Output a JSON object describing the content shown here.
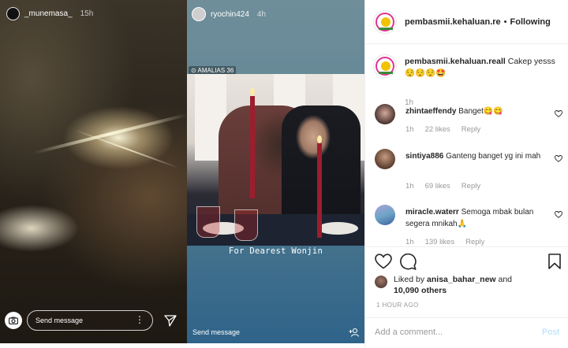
{
  "story1": {
    "username": "_munemasa_",
    "time": "15h",
    "message_placeholder": "Send message"
  },
  "story2": {
    "username": "ryochin424",
    "time": "4h",
    "photo_tag": "AMALIAS 36",
    "caption": "For Dearest Wonjin",
    "message_placeholder": "Send message"
  },
  "post": {
    "header": {
      "username": "pembasmii.kehaluan.re",
      "separator": "•",
      "follow_label": "Following",
      "more": "•••"
    },
    "caption": {
      "username": "pembasmii.kehaluan.reall",
      "text": "Cakep yesss 😌😌😌🤩",
      "time": "1h"
    },
    "comments": [
      {
        "username": "zhintaeffendy",
        "text": "Banget😋😋",
        "time": "1h",
        "likes": "22 likes",
        "reply": "Reply"
      },
      {
        "username": "sintiya886",
        "text": "Ganteng banget yg ini mah",
        "time": "1h",
        "likes": "69 likes",
        "reply": "Reply"
      },
      {
        "username": "miracle.waterr",
        "text": "Semoga mbak bulan segera mnikah🙏",
        "time": "1h",
        "likes": "139 likes",
        "reply": "Reply"
      }
    ],
    "liked_by_prefix": "Liked by",
    "liked_by_user": "anisa_bahar_new",
    "liked_by_and": "and",
    "likes_count": "10,090 others",
    "post_time": "1 HOUR AGO",
    "add_comment_placeholder": "Add a comment...",
    "post_label": "Post",
    "colors": {
      "link_blue": "#b2dffc",
      "text": "#262626",
      "muted": "#999999"
    }
  }
}
